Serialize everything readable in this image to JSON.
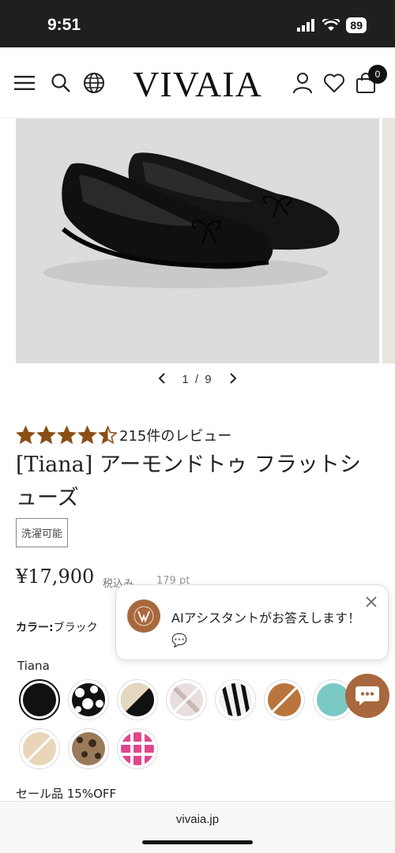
{
  "status": {
    "time": "9:51",
    "battery": "89"
  },
  "header": {
    "logo": "VIVAIA",
    "cart_count": "0"
  },
  "gallery": {
    "current": "1",
    "separator": "/",
    "total": "9"
  },
  "product": {
    "rating": 4.5,
    "review_text": "215件のレビュー",
    "title": "[Tiana] アーモンドトゥ フラットシューズ",
    "tag": "洗濯可能",
    "price": "¥17,900",
    "tax_note": "税込み",
    "points": "179 pt",
    "color_label": "カラー:",
    "color_value": "ブラック",
    "variant_name": "Tiana",
    "sale_text": "セール品 15%OFF"
  },
  "swatches": [
    {
      "name": "black",
      "selected": true
    },
    {
      "name": "black-white-dots",
      "selected": false
    },
    {
      "name": "beige-black",
      "selected": false
    },
    {
      "name": "pink-white-weave",
      "selected": false
    },
    {
      "name": "black-white-zebra",
      "selected": false
    },
    {
      "name": "tan-brown",
      "selected": false
    },
    {
      "name": "aqua",
      "selected": false
    },
    {
      "name": "beige-stripe",
      "selected": false
    },
    {
      "name": "leopard",
      "selected": false
    },
    {
      "name": "pink-check",
      "selected": false
    }
  ],
  "assistant": {
    "message": "AIアシスタントがお答えします！💬"
  },
  "browser": {
    "url": "vivaia.jp"
  },
  "colors": {
    "accent": "#a8683d",
    "star": "#8a4f14",
    "image_bg": "#dcdcdc"
  }
}
